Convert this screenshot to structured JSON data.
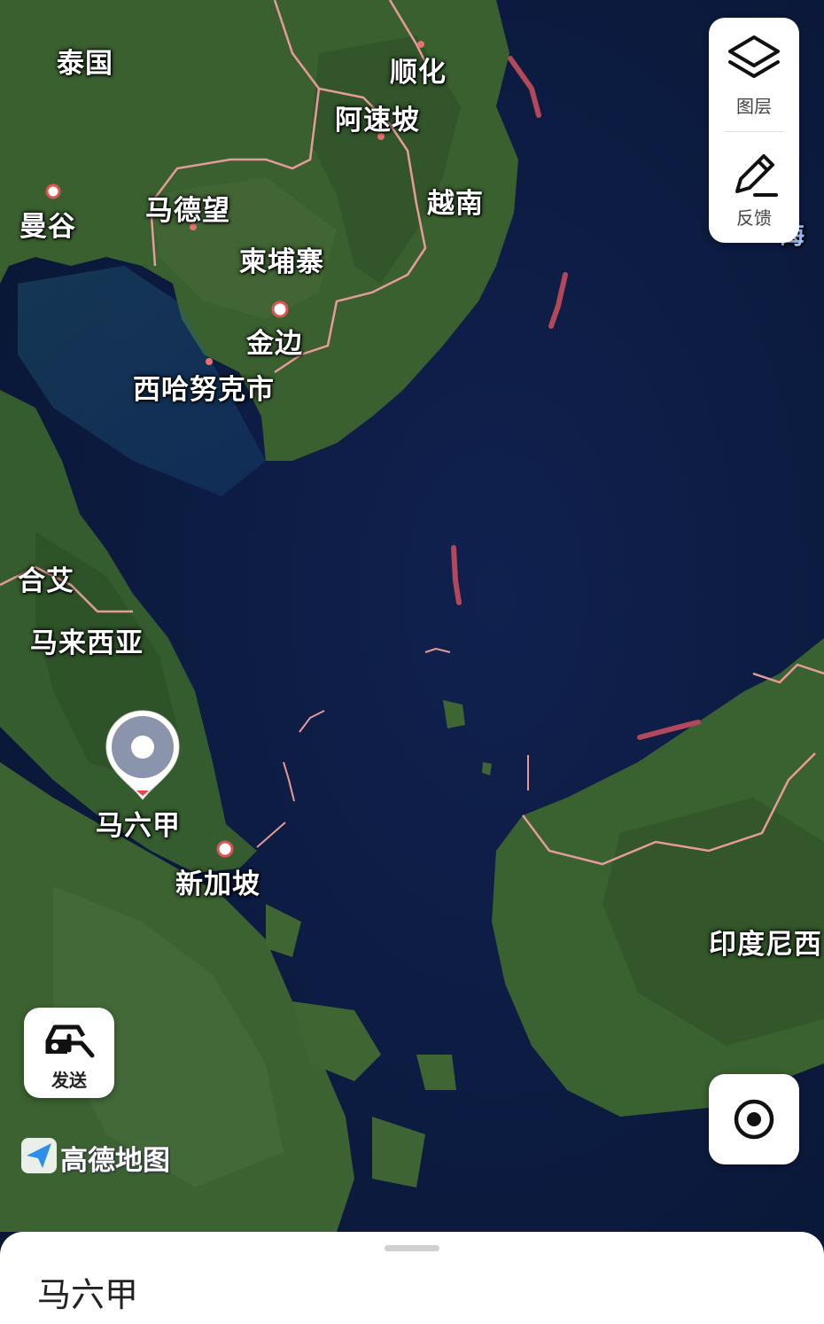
{
  "map": {
    "labels": {
      "thailand": "泰国",
      "hue": "顺化",
      "a_luoi": "阿速坡",
      "bangkok": "曼谷",
      "battambang": "马德望",
      "vietnam": "越南",
      "cambodia": "柬埔寨",
      "phnom_penh": "金边",
      "sihanoukville": "西哈努克市",
      "hat_yai": "合艾",
      "malaysia": "马来西亚",
      "malacca": "马六甲",
      "singapore": "新加坡",
      "indonesia": "印度尼西",
      "sea_partial": "海"
    },
    "colors": {
      "sea": "#0d1c45",
      "land": "#2f5a2c",
      "border": "#e79a9a",
      "dashed_line": "#b2485a"
    }
  },
  "controls": {
    "layers_label": "图层",
    "feedback_label": "反馈",
    "send_label": "发送",
    "locate_icon": "locate-icon"
  },
  "brand": {
    "logo_text": "高德地图"
  },
  "bottom_sheet": {
    "title": "马六甲"
  }
}
